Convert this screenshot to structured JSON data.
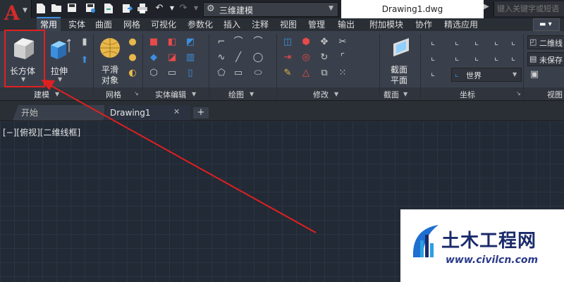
{
  "titlebar": {
    "app_logo": "A",
    "workspace": "三维建模",
    "document_title": "Drawing1.dwg",
    "search_placeholder": "键入关键字或短语"
  },
  "quick_access": [
    "new-icon",
    "open-icon",
    "save-icon",
    "save-as-icon",
    "export-icon",
    "print-icon",
    "undo-icon",
    "redo-icon"
  ],
  "ribbon_tabs": [
    {
      "label": "常用",
      "active": true
    },
    {
      "label": "实体"
    },
    {
      "label": "曲面"
    },
    {
      "label": "网格"
    },
    {
      "label": "可视化"
    },
    {
      "label": "参数化"
    },
    {
      "label": "插入"
    },
    {
      "label": "注释"
    },
    {
      "label": "视图"
    },
    {
      "label": "管理"
    },
    {
      "label": "输出"
    },
    {
      "label": "附加模块"
    },
    {
      "label": "协作"
    },
    {
      "label": "精选应用"
    }
  ],
  "panels": {
    "modeling": {
      "title": "建模",
      "box_label": "长方体",
      "extrude_label": "拉伸"
    },
    "mesh": {
      "title": "网格",
      "smooth_label_1": "平滑",
      "smooth_label_2": "对象"
    },
    "solid_edit": {
      "title": "实体编辑"
    },
    "draw": {
      "title": "绘图"
    },
    "modify": {
      "title": "修改"
    },
    "section": {
      "title": "截面",
      "section_label_1": "截面",
      "section_label_2": "平面"
    },
    "coordinates": {
      "title": "坐标",
      "world_label": "世界"
    },
    "view": {
      "title": "视图",
      "visual_style": "二维线",
      "unsaved": "未保存"
    }
  },
  "file_tabs": {
    "start": "开始",
    "drawing": "Drawing1",
    "close": "✕",
    "new": "+"
  },
  "viewport": {
    "label": "[−][俯视][二维线框]"
  },
  "watermark": {
    "title": "土木工程网",
    "url": "www.civilcn.com"
  },
  "colors": {
    "accent_red": "#e02020",
    "ribbon_bg": "#3a404b",
    "canvas_bg": "#222a36"
  }
}
